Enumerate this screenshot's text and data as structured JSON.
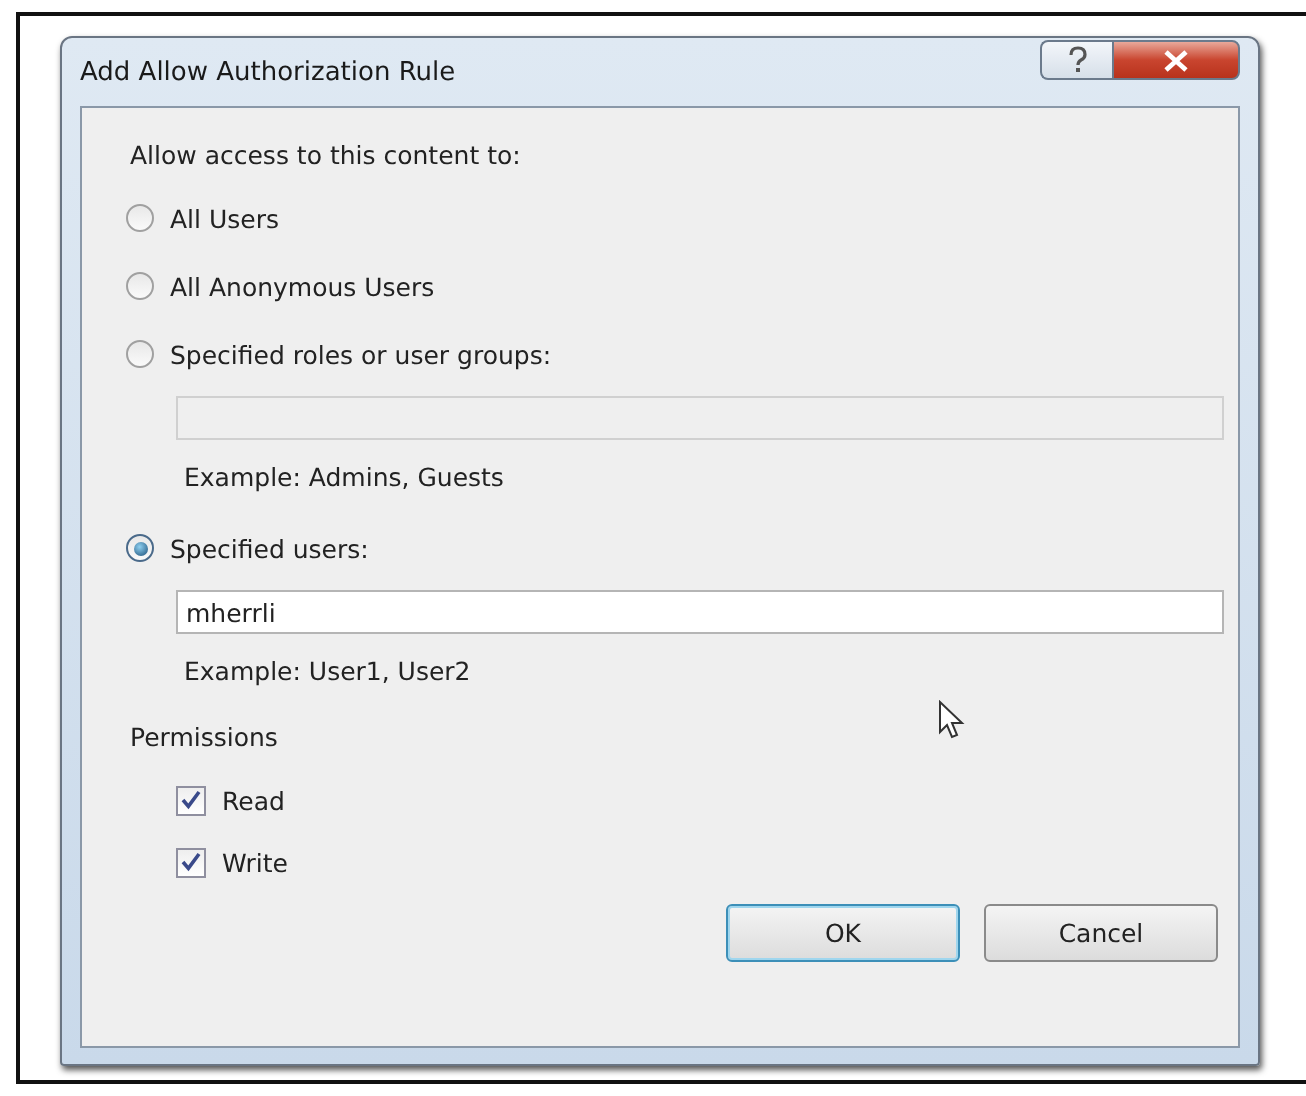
{
  "window": {
    "title": "Add Allow Authorization Rule"
  },
  "prompt": "Allow access to this content to:",
  "options": [
    {
      "label": "All Users",
      "selected": false
    },
    {
      "label": "All Anonymous Users",
      "selected": false
    },
    {
      "label": "Specified roles or user groups:",
      "selected": false,
      "field": {
        "disabled": true
      },
      "example": "Example: Admins, Guests"
    },
    {
      "label": "Specified users:",
      "selected": true,
      "field": {
        "value": "mherrli",
        "disabled": false
      },
      "example": "Example: User1, User2"
    }
  ],
  "permissions": {
    "label": "Permissions",
    "items": [
      {
        "label": "Read",
        "checked": true
      },
      {
        "label": "Write",
        "checked": true
      }
    ]
  },
  "buttons": [
    {
      "label": "OK",
      "default": true
    },
    {
      "label": "Cancel",
      "default": false
    }
  ]
}
